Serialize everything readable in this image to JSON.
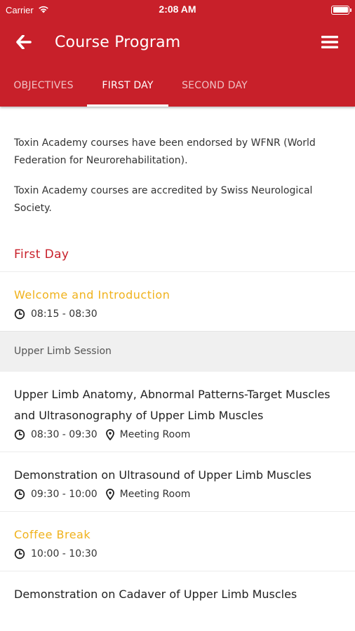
{
  "status_bar": {
    "carrier": "Carrier",
    "time": "2:08 AM"
  },
  "nav": {
    "title": "Course Program"
  },
  "tabs": [
    {
      "label": "OBJECTIVES"
    },
    {
      "label": "FIRST DAY"
    },
    {
      "label": "SECOND DAY"
    }
  ],
  "intro": [
    "Toxin Academy courses have been endorsed by WFNR (World Federation for Neurorehabilitation).",
    "Toxin Academy courses are accredited by Swiss Neurological Society."
  ],
  "section_title": "First Day",
  "schedule": {
    "welcome": {
      "title": "Welcome and Introduction",
      "time": "08:15 - 08:30"
    },
    "session": "Upper Limb Session",
    "anatomy": {
      "title": "Upper Limb Anatomy, Abnormal Patterns-Target Muscles and Ultrasonography of Upper Limb Muscles",
      "time": "08:30 - 09:30",
      "location": "Meeting Room"
    },
    "demo_ultrasound": {
      "title": "Demonstration on Ultrasound of Upper Limb Muscles",
      "time": "09:30 - 10:00",
      "location": "Meeting Room"
    },
    "coffee": {
      "title": "Coffee Break",
      "time": "10:00 - 10:30"
    },
    "demo_cadaver": {
      "title": "Demonstration on Cadaver of Upper Limb Muscles"
    }
  },
  "colors": {
    "brand_red": "#c8202a",
    "highlight_yellow": "#f0b21c"
  }
}
